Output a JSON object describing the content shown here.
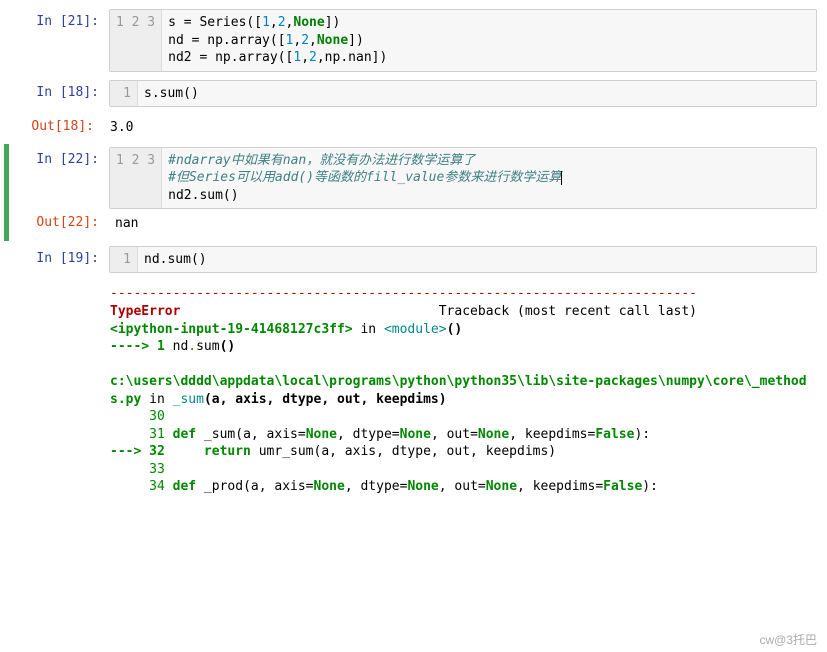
{
  "cells": [
    {
      "prompt_in": "In [21]:",
      "gutter": [
        "1",
        "2",
        "3"
      ],
      "code_lines": [
        [
          {
            "t": "s = Series(["
          },
          {
            "t": "1",
            "c": "num"
          },
          {
            "t": ","
          },
          {
            "t": "2",
            "c": "num"
          },
          {
            "t": ","
          },
          {
            "t": "None",
            "c": "kw"
          },
          {
            "t": "])"
          }
        ],
        [
          {
            "t": "nd = np.array(["
          },
          {
            "t": "1",
            "c": "num"
          },
          {
            "t": ","
          },
          {
            "t": "2",
            "c": "num"
          },
          {
            "t": ","
          },
          {
            "t": "None",
            "c": "kw"
          },
          {
            "t": "])"
          }
        ],
        [
          {
            "t": "nd2 = np.array(["
          },
          {
            "t": "1",
            "c": "num"
          },
          {
            "t": ","
          },
          {
            "t": "2",
            "c": "num"
          },
          {
            "t": ",np.nan])"
          }
        ]
      ]
    },
    {
      "prompt_in": "In [18]:",
      "gutter": [
        "1"
      ],
      "code_lines": [
        [
          {
            "t": "s.sum()"
          }
        ]
      ],
      "prompt_out": "Out[18]:",
      "output": "3.0"
    },
    {
      "selected": true,
      "prompt_in": "In [22]:",
      "gutter": [
        "1",
        "2",
        "3"
      ],
      "code_lines": [
        [
          {
            "t": "#ndarray中如果有nan，就没有办法进行数学运算了",
            "c": "cm"
          }
        ],
        [
          {
            "t": "#但Series可以用add()等函数的fill_value参数来进行数学运算",
            "c": "cm",
            "cursor": true
          }
        ],
        [
          {
            "t": "nd2.sum()"
          }
        ]
      ],
      "prompt_out": "Out[22]:",
      "output": "nan"
    },
    {
      "prompt_in": "In [19]:",
      "gutter": [
        "1"
      ],
      "code_lines": [
        [
          {
            "t": "nd.sum()"
          }
        ]
      ],
      "traceback": {
        "dash_line": "---------------------------------------------------------------------------",
        "err_name": "TypeError",
        "err_head_rest": "                                 Traceback (most recent call last)",
        "ipython_input": "<ipython-input-19-41468127c3ff>",
        "in_kw": " in ",
        "module": "<module>",
        "paren": "()",
        "arrow1": "----> 1 ",
        "arrow1_code": [
          {
            "t": "nd"
          },
          {
            "t": "."
          },
          {
            "t": "sum"
          },
          {
            "t": "()"
          }
        ],
        "path": "c:\\users\\dddd\\appdata\\local\\programs\\python\\python35\\lib\\site-packages\\numpy\\core\\_methods.py",
        "in_kw2": " in ",
        "fn_name": "_sum",
        "sig": "(a, axis, dtype, out, keepdims)",
        "line30": "     30 ",
        "line31_pre": "     31 ",
        "line31_def": "def",
        "line31_rest": " _sum(a, axis=",
        "line31_none1": "None",
        "line31_m1": ", dtype=",
        "line31_none2": "None",
        "line31_m2": ", out=",
        "line31_none3": "None",
        "line31_m3": ", keepdims=",
        "line31_false": "False",
        "line31_end": "):",
        "arrow32": "---> 32     ",
        "line32_ret": "return",
        "line32_rest": " umr_sum(a, axis, dtype, out, keepdims)",
        "line33": "     33 ",
        "line34_pre": "     34 ",
        "line34_def": "def",
        "line34_rest": " _prod(a, axis=",
        "line34_none1": "None",
        "line34_m1": ", dtype=",
        "line34_none2": "None",
        "line34_m2": ", out=",
        "line34_none3": "None",
        "line34_m3": ", keepdims=",
        "line34_false": "False",
        "line34_end": "):"
      }
    }
  ],
  "watermark": "cw@3托巴"
}
